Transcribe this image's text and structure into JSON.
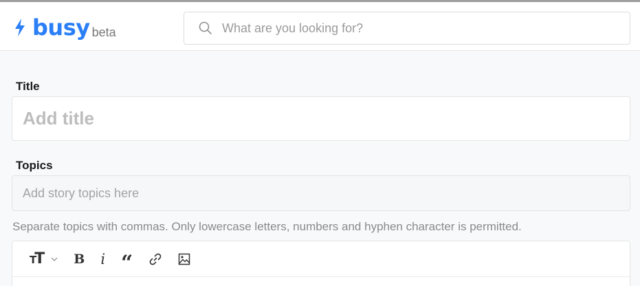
{
  "brand": {
    "name": "busy",
    "tag": "beta",
    "accent": "#2a7ef6"
  },
  "search": {
    "placeholder": "What are you looking for?",
    "value": ""
  },
  "form": {
    "title_label": "Title",
    "title_placeholder": "Add title",
    "title_value": "",
    "topics_label": "Topics",
    "topics_placeholder": "Add story topics here",
    "topics_value": "",
    "topics_hint": "Separate topics with commas. Only lowercase letters, numbers and hyphen character is permitted."
  },
  "toolbar": {
    "heading_icon": "text-size-icon",
    "bold_icon": "bold-icon",
    "italic_icon": "italic-icon",
    "quote_icon": "quote-icon",
    "link_icon": "link-icon",
    "image_icon": "image-icon"
  }
}
